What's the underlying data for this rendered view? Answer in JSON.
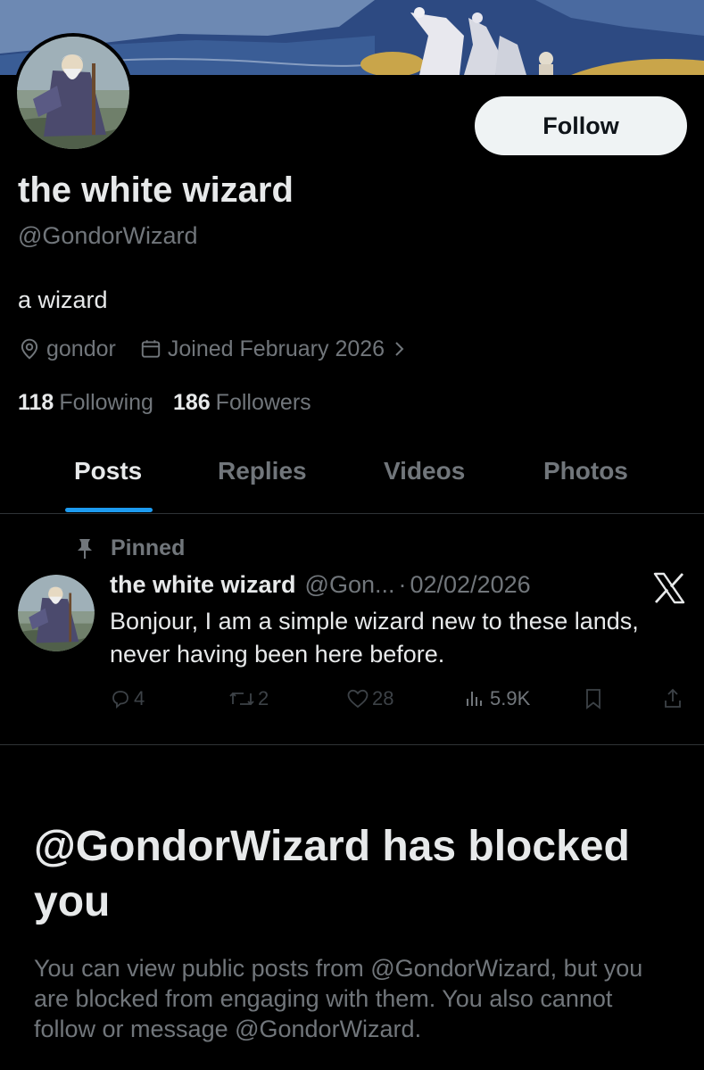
{
  "profile": {
    "display_name": "the white wizard",
    "handle": "@GondorWizard",
    "bio": "a wizard",
    "location": "gondor",
    "joined": "Joined February 2026",
    "following_count": "118",
    "following_label": "Following",
    "followers_count": "186",
    "followers_label": "Followers"
  },
  "follow_button": {
    "label": "Follow"
  },
  "tabs": [
    {
      "label": "Posts",
      "active": true
    },
    {
      "label": "Replies",
      "active": false
    },
    {
      "label": "Videos",
      "active": false
    },
    {
      "label": "Photos",
      "active": false
    }
  ],
  "pinned_post": {
    "pinned_label": "Pinned",
    "author_name": "the white wizard",
    "author_handle": "@Gon...",
    "separator": "·",
    "date": "02/02/2026",
    "text": "Bonjour, I am a simple wizard new to these lands, never having been here before.",
    "replies": "4",
    "reposts": "2",
    "likes": "28",
    "views": "5.9K"
  },
  "blocked": {
    "title": "@GondorWizard has blocked you",
    "description": "You can view public posts from @GondorWizard, but you are blocked from engaging with them. You also cannot follow or message @GondorWizard."
  },
  "icons": {
    "location": "location-pin-icon",
    "calendar": "calendar-icon",
    "chevron": "chevron-right-icon",
    "pin": "pin-icon",
    "brand": "x-logo-icon",
    "reply": "reply-icon",
    "repost": "repost-icon",
    "like": "heart-icon",
    "views": "views-icon",
    "bookmark": "bookmark-icon",
    "share": "share-icon"
  },
  "colors": {
    "background": "#000000",
    "primary_text": "#e7e9ea",
    "secondary_text": "#71767b",
    "accent": "#1d9bf0",
    "button_bg": "#eff3f4",
    "divider": "#2f3336"
  }
}
